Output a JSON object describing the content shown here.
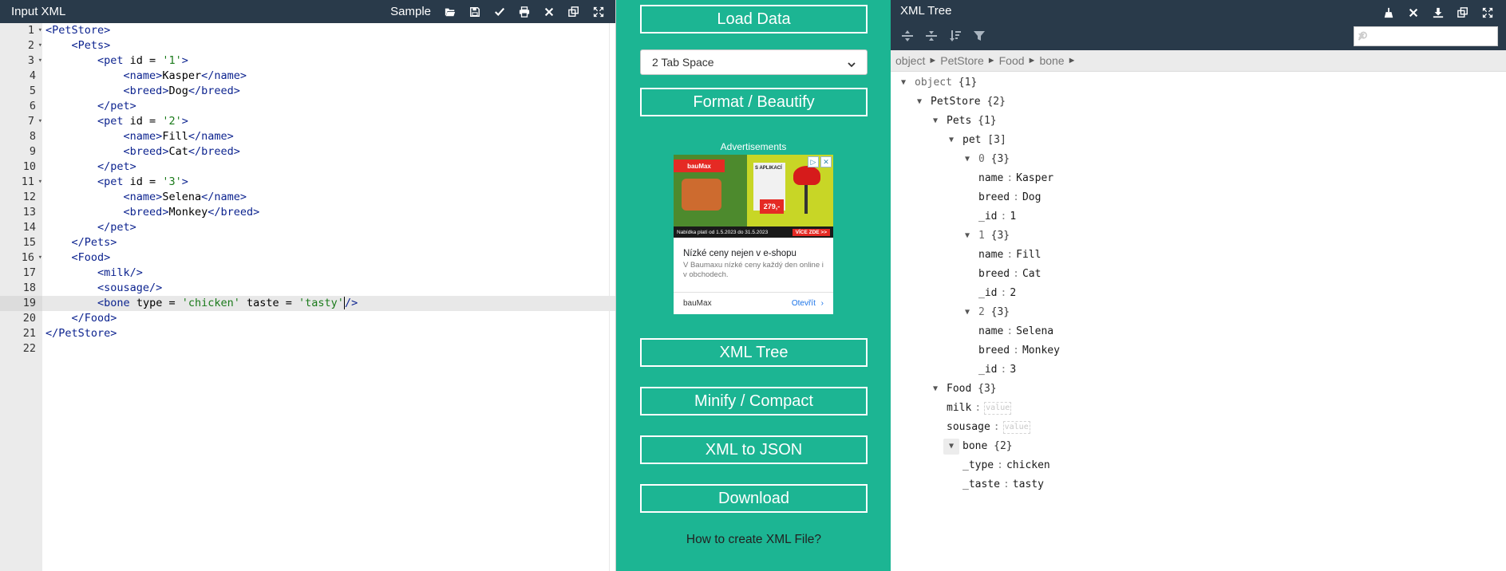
{
  "left": {
    "title": "Input XML",
    "sample_label": "Sample",
    "lines": [
      [
        [
          "tag",
          "<PetStore>"
        ]
      ],
      [
        [
          "ws",
          "    "
        ],
        [
          "tag",
          "<Pets>"
        ]
      ],
      [
        [
          "ws",
          "        "
        ],
        [
          "tag",
          "<pet "
        ],
        [
          "attr",
          "id = "
        ],
        [
          "str",
          "'1'"
        ],
        [
          "tag",
          ">"
        ]
      ],
      [
        [
          "ws",
          "            "
        ],
        [
          "tag",
          "<name>"
        ],
        [
          "text",
          "Kasper"
        ],
        [
          "tag",
          "</name>"
        ]
      ],
      [
        [
          "ws",
          "            "
        ],
        [
          "tag",
          "<breed>"
        ],
        [
          "text",
          "Dog"
        ],
        [
          "tag",
          "</breed>"
        ]
      ],
      [
        [
          "ws",
          "        "
        ],
        [
          "tag",
          "</pet>"
        ]
      ],
      [
        [
          "ws",
          "        "
        ],
        [
          "tag",
          "<pet "
        ],
        [
          "attr",
          "id = "
        ],
        [
          "str",
          "'2'"
        ],
        [
          "tag",
          ">"
        ]
      ],
      [
        [
          "ws",
          "            "
        ],
        [
          "tag",
          "<name>"
        ],
        [
          "text",
          "Fill"
        ],
        [
          "tag",
          "</name>"
        ]
      ],
      [
        [
          "ws",
          "            "
        ],
        [
          "tag",
          "<breed>"
        ],
        [
          "text",
          "Cat"
        ],
        [
          "tag",
          "</breed>"
        ]
      ],
      [
        [
          "ws",
          "        "
        ],
        [
          "tag",
          "</pet>"
        ]
      ],
      [
        [
          "ws",
          "        "
        ],
        [
          "tag",
          "<pet "
        ],
        [
          "attr",
          "id = "
        ],
        [
          "str",
          "'3'"
        ],
        [
          "tag",
          ">"
        ]
      ],
      [
        [
          "ws",
          "            "
        ],
        [
          "tag",
          "<name>"
        ],
        [
          "text",
          "Selena"
        ],
        [
          "tag",
          "</name>"
        ]
      ],
      [
        [
          "ws",
          "            "
        ],
        [
          "tag",
          "<breed>"
        ],
        [
          "text",
          "Monkey"
        ],
        [
          "tag",
          "</breed>"
        ]
      ],
      [
        [
          "ws",
          "        "
        ],
        [
          "tag",
          "</pet>"
        ]
      ],
      [
        [
          "ws",
          "    "
        ],
        [
          "tag",
          "</Pets>"
        ]
      ],
      [
        [
          "ws",
          "    "
        ],
        [
          "tag",
          "<Food>"
        ]
      ],
      [
        [
          "ws",
          "        "
        ],
        [
          "tag",
          "<milk/>"
        ]
      ],
      [
        [
          "ws",
          "        "
        ],
        [
          "tag",
          "<sousage/>"
        ]
      ],
      [
        [
          "ws",
          "        "
        ],
        [
          "tag",
          "<bone "
        ],
        [
          "attr",
          "type = "
        ],
        [
          "str",
          "'chicken'"
        ],
        [
          "attr",
          " taste = "
        ],
        [
          "str",
          "'tasty'"
        ],
        [
          "tag",
          "/>"
        ]
      ],
      [
        [
          "ws",
          "    "
        ],
        [
          "tag",
          "</Food>"
        ]
      ],
      [
        [
          "tag",
          "</PetStore>"
        ]
      ],
      [
        [
          "ws",
          ""
        ]
      ]
    ],
    "line_numbers": [
      "1",
      "2",
      "3",
      "4",
      "5",
      "6",
      "7",
      "8",
      "9",
      "10",
      "11",
      "12",
      "13",
      "14",
      "15",
      "16",
      "17",
      "18",
      "19",
      "20",
      "21",
      "22"
    ],
    "fold_lines": [
      "1",
      "2",
      "3",
      "7",
      "11",
      "16"
    ],
    "active_line": 19
  },
  "middle": {
    "load_label": "Load Data",
    "select_value": "2 Tab Space",
    "format_label": "Format / Beautify",
    "ads_label": "Advertisements",
    "ad": {
      "banner_brand": "bauMax",
      "banner_tag": "S APLIKACÍ",
      "banner_price": "279,-",
      "banner_strip": "Nabídka platí od 1.5.2023 do 31.5.2023",
      "banner_cta": "VÍCE ZDE >>",
      "headline": "Nízké ceny nejen v e-shopu",
      "description": "V Baumaxu nízké ceny každý den online i v obchodech.",
      "advertiser": "bauMax",
      "open_label": "Otevřít"
    },
    "tree_label": "XML Tree",
    "minify_label": "Minify / Compact",
    "json_label": "XML to JSON",
    "download_label": "Download",
    "how_link": "How to create XML File?"
  },
  "right": {
    "title": "XML Tree",
    "breadcrumb": [
      "object",
      "PetStore",
      "Food",
      "bone"
    ],
    "tree": [
      {
        "depth": 0,
        "key": "object",
        "count": "{1}",
        "toggle": true,
        "muted": true
      },
      {
        "depth": 1,
        "key": "PetStore",
        "count": "{2}",
        "toggle": true
      },
      {
        "depth": 2,
        "key": "Pets",
        "count": "{1}",
        "toggle": true
      },
      {
        "depth": 3,
        "key": "pet",
        "count": "[3]",
        "toggle": true
      },
      {
        "depth": 4,
        "key": "0",
        "count": "{3}",
        "toggle": true,
        "muted": true
      },
      {
        "depth": 5,
        "key": "name",
        "value": "Kasper"
      },
      {
        "depth": 5,
        "key": "breed",
        "value": "Dog"
      },
      {
        "depth": 5,
        "key": "_id",
        "value": "1"
      },
      {
        "depth": 4,
        "key": "1",
        "count": "{3}",
        "toggle": true,
        "muted": true
      },
      {
        "depth": 5,
        "key": "name",
        "value": "Fill"
      },
      {
        "depth": 5,
        "key": "breed",
        "value": "Cat"
      },
      {
        "depth": 5,
        "key": "_id",
        "value": "2"
      },
      {
        "depth": 4,
        "key": "2",
        "count": "{3}",
        "toggle": true,
        "muted": true
      },
      {
        "depth": 5,
        "key": "name",
        "value": "Selena"
      },
      {
        "depth": 5,
        "key": "breed",
        "value": "Monkey"
      },
      {
        "depth": 5,
        "key": "_id",
        "value": "3"
      },
      {
        "depth": 2,
        "key": "Food",
        "count": "{3}",
        "toggle": true
      },
      {
        "depth": 3,
        "key": "milk",
        "empty": "value"
      },
      {
        "depth": 3,
        "key": "sousage",
        "empty": "value"
      },
      {
        "depth": 3,
        "key": "bone",
        "count": "{2}",
        "toggle": true,
        "boxed": true
      },
      {
        "depth": 4,
        "key": "_type",
        "value": "chicken"
      },
      {
        "depth": 4,
        "key": "_taste",
        "value": "tasty"
      }
    ]
  },
  "colors": {
    "header_bg": "#293a4a",
    "accent_green": "#1cb593",
    "tag_blue": "#0c238f",
    "string_green": "#1a7a1a"
  },
  "icons": {
    "left_header": [
      "folder-open-icon",
      "save-icon",
      "check-icon",
      "print-icon",
      "close-icon",
      "copy-icon",
      "fullscreen-icon"
    ],
    "right_header": [
      "broom-icon",
      "close-icon",
      "download-icon",
      "copy-icon",
      "fullscreen-icon"
    ],
    "tree_toolbar": [
      "expand-all-icon",
      "collapse-all-icon",
      "sort-icon",
      "filter-icon"
    ]
  }
}
